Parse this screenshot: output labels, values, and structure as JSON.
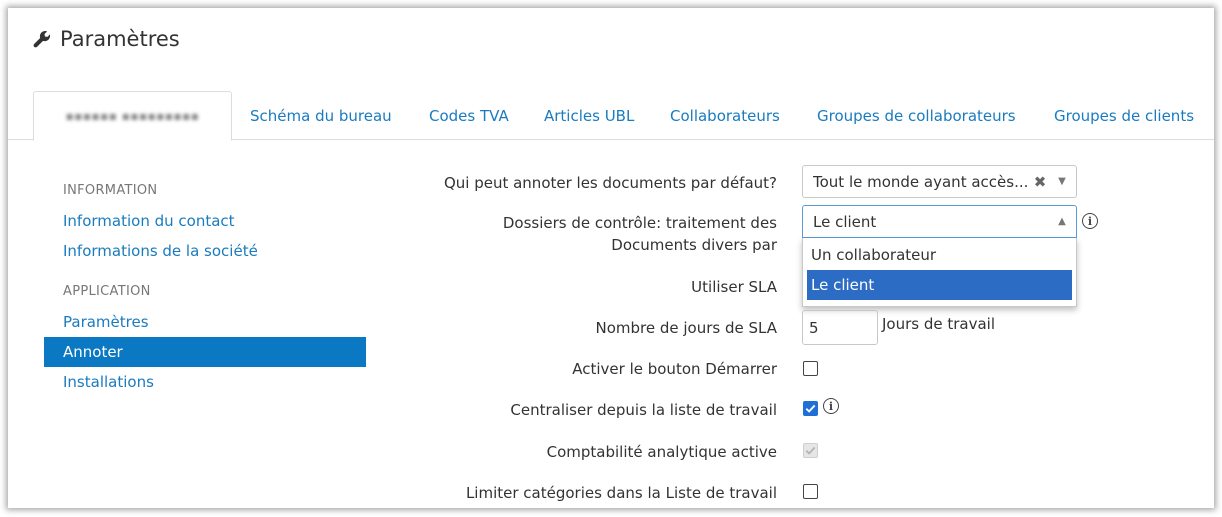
{
  "header": {
    "title": "Paramètres",
    "icon": "wrench-icon"
  },
  "tabs": [
    {
      "label": "▪▪▪▪▪▪ ▪▪▪▪▪▪▪▪▪"
    },
    {
      "label": "Schéma du bureau"
    },
    {
      "label": "Codes TVA"
    },
    {
      "label": "Articles UBL"
    },
    {
      "label": "Collaborateurs"
    },
    {
      "label": "Groupes de collaborateurs"
    },
    {
      "label": "Groupes de clients"
    }
  ],
  "sidebar": {
    "section_info": "Information",
    "contact": "Information du contact",
    "company": "Informations de la société",
    "section_app": "Application",
    "settings": "Paramètres",
    "annotate": "Annoter",
    "installations": "Installations"
  },
  "form": {
    "annotate_label": "Qui peut annoter les documents par défaut?",
    "annotate_value": "Tout le monde ayant accès...",
    "control_label_1": "Dossiers de contrôle: traitement des",
    "control_label_2": "Documents divers par",
    "control_value": "Le client",
    "control_options": [
      "Un collaborateur",
      "Le client"
    ],
    "sla_label": "Utiliser SLA",
    "sla_days_label": "Nombre de jours de SLA",
    "sla_days_value": "5",
    "sla_days_unit": "Jours de travail",
    "start_button_label": "Activer le bouton Démarrer",
    "centralize_label": "Centraliser depuis la liste de travail",
    "analytic_label": "Comptabilité analytique active",
    "limit_label": "Limiter catégories dans la Liste de travail"
  },
  "colors": {
    "link": "#1a7bbf",
    "active_bg": "#0a78c2",
    "selected_option": "#2c6cc4",
    "checkbox": "#1f6fd6"
  }
}
